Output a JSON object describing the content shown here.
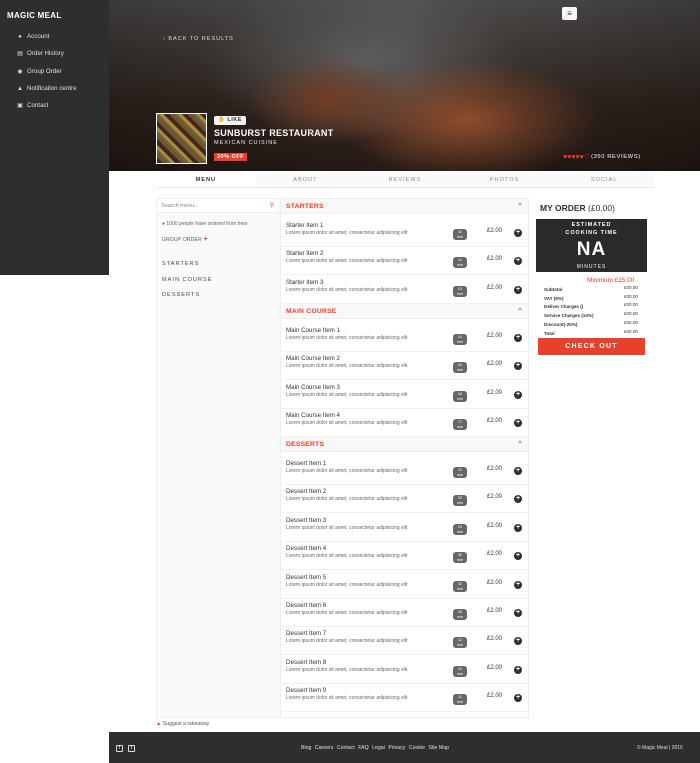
{
  "app": {
    "brand": "MAGIC MEAL"
  },
  "sidebar": {
    "items": [
      {
        "label": "Account",
        "icon": "user-icon"
      },
      {
        "label": "Order History",
        "icon": "cart-icon"
      },
      {
        "label": "Group Order",
        "icon": "group-icon"
      },
      {
        "label": "Notification centre",
        "icon": "bell-icon"
      },
      {
        "label": "Contact",
        "icon": "contact-icon"
      }
    ]
  },
  "hero": {
    "back_label": "‹ BACK TO RESULTS",
    "menu_icon": "≡",
    "like_label": "LIKE",
    "restaurant_name": "SUNBURST RESTAURANT",
    "cuisine": "MEXICAN CUISINE",
    "discount": "20% OFF",
    "hearts": "♥♥♥♥♥♡",
    "reviews": "(350 REVIEWS)"
  },
  "tabs": [
    "MENU",
    "ABOUT",
    "REVIEWS",
    "PHOTOS",
    "SOCIAL"
  ],
  "filter": {
    "search_placeholder": "Search menu...",
    "orders_note": "1000 people have ordered from here",
    "group_order": "GROUP ORDER",
    "categories": [
      "STARTERS",
      "MAIN COURSE",
      "DESSERTS"
    ]
  },
  "menu": {
    "sections": [
      {
        "title": "STARTERS",
        "items": [
          {
            "name": "Starter Item 1",
            "desc": "Lorem ipsum dolor sit amet, consectetur adipisicing elit",
            "time": "11",
            "unit": "min",
            "price": "£2.00"
          },
          {
            "name": "Starter Item 2",
            "desc": "Lorem ipsum dolor sit amet, consectetur adipisicing elit",
            "time": "12",
            "unit": "min",
            "price": "£2.00"
          },
          {
            "name": "Starter Item 3",
            "desc": "Lorem ipsum dolor sit amet, consectetur adipisicing elit",
            "time": "13",
            "unit": "min",
            "price": "£2.00"
          }
        ]
      },
      {
        "title": "MAIN COURSE",
        "items": [
          {
            "name": "Main Course Item 1",
            "desc": "Lorem ipsum dolor sit amet, consectetur adipisicing elit",
            "time": "14",
            "unit": "min",
            "price": "£2.00"
          },
          {
            "name": "Main Course Item 2",
            "desc": "Lorem ipsum dolor sit amet, consectetur adipisicing elit",
            "time": "15",
            "unit": "min",
            "price": "£2.00"
          },
          {
            "name": "Main Course Item 3",
            "desc": "Lorem ipsum dolor sit amet, consectetur adipisicing elit",
            "time": "16",
            "unit": "min",
            "price": "£2.00"
          },
          {
            "name": "Main Course Item 4",
            "desc": "Lorem ipsum dolor sit amet, consectetur adipisicing elit",
            "time": "17",
            "unit": "min",
            "price": "£2.00"
          }
        ]
      },
      {
        "title": "DESSERTS",
        "items": [
          {
            "name": "Dessert Item 1",
            "desc": "Lorem ipsum dolor sit amet, consectetur adipisicing elit",
            "time": "21",
            "unit": "min",
            "price": "£2.00"
          },
          {
            "name": "Dessert Item 2",
            "desc": "Lorem ipsum dolor sit amet, consectetur adipisicing elit",
            "time": "22",
            "unit": "min",
            "price": "£2.00"
          },
          {
            "name": "Dessert Item 3",
            "desc": "Lorem ipsum dolor sit amet, consectetur adipisicing elit",
            "time": "23",
            "unit": "min",
            "price": "£2.00"
          },
          {
            "name": "Dessert Item 4",
            "desc": "Lorem ipsum dolor sit amet, consectetur adipisicing elit",
            "time": "30",
            "unit": "min",
            "price": "£2.00"
          },
          {
            "name": "Dessert Item 5",
            "desc": "Lorem ipsum dolor sit amet, consectetur adipisicing elit",
            "time": "32",
            "unit": "min",
            "price": "£2.00"
          },
          {
            "name": "Dessert Item 6",
            "desc": "Lorem ipsum dolor sit amet, consectetur adipisicing elit",
            "time": "25",
            "unit": "min",
            "price": "£2.00"
          },
          {
            "name": "Dessert Item 7",
            "desc": "Lorem ipsum dolor sit amet, consectetur adipisicing elit",
            "time": "12",
            "unit": "min",
            "price": "£2.00"
          },
          {
            "name": "Dessert Item 8",
            "desc": "Lorem ipsum dolor sit amet, consectetur adipisicing elit",
            "time": "31",
            "unit": "min",
            "price": "£2.00"
          },
          {
            "name": "Dessert Item 9",
            "desc": "Lorem ipsum dolor sit amet, consectetur adipisicing elit",
            "time": "11",
            "unit": "min",
            "price": "£2.00"
          }
        ]
      }
    ]
  },
  "order": {
    "title": "MY ORDER",
    "amount": "(£0.00)",
    "cook_label_1": "ESTIMATED",
    "cook_label_2": "COOKING TIME",
    "cook_value": "NA",
    "cook_unit": "MINUTES",
    "minimum": "Minimum £15.00",
    "summary": [
      {
        "label": "Subtotal",
        "value": "£00.00"
      },
      {
        "label": "VAT (5%)",
        "value": "£00.00"
      },
      {
        "label": "Deliver Charges ()",
        "value": "£00.00"
      },
      {
        "label": "Service Charges (10%)",
        "value": "£00.00"
      },
      {
        "label": "Discount(-20%)",
        "value": "£00.00"
      },
      {
        "label": "Total",
        "value": "£00.00"
      }
    ],
    "checkout_label": "CHECK OUT"
  },
  "suggest": "Suggest a takeaway",
  "footer": {
    "links": [
      "Blog",
      "Careers",
      "Contact",
      "FAQ",
      "Legal",
      "Privacy",
      "Cookie",
      "Site Map"
    ],
    "copyright": "© Magic Meal | 2016"
  },
  "colors": {
    "accent": "#e8402a",
    "dark": "#2e2e2e"
  }
}
